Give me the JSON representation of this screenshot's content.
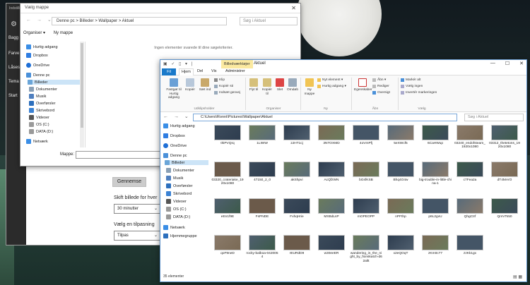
{
  "settings": {
    "title": "Indstillinger",
    "sidebar": [
      "Bagg",
      "Farve",
      "Låsesk",
      "Tema",
      "Start"
    ],
    "browse_button": "Gennemse",
    "time_label": "Skift billede for hver",
    "time_value": "30 minutter",
    "fit_label": "Vælg en tilpasning",
    "fit_value": "Tilpas"
  },
  "dialog": {
    "title": "Vælg mappe",
    "breadcrumb": "Denne pc  >  Billeder  >  Wallpaper  >  Aktuel",
    "search_placeholder": "Søg i Aktuel",
    "toolbar": {
      "organize": "Organiser ▾",
      "new_folder": "Ny mappe"
    },
    "nav_items": [
      "Hurtig adgang",
      "Dropbox",
      "OneDrive",
      "Denne pc",
      "Billeder",
      "Dokumenter",
      "Musik",
      "Overførsler",
      "Skrivebord",
      "Videoer",
      "OS (C:)",
      "DATA (D:)",
      "Netværk"
    ],
    "empty_message": "Ingen elementer svarede til dine søgekriterier.",
    "folder_label": "Mappe:"
  },
  "explorer": {
    "title": "Aktuel",
    "tools_tab": "Billedværktøjer",
    "ribbon_tabs": [
      "Fil",
      "Hjem",
      "Del",
      "Vis",
      "Administrer"
    ],
    "address": "C:\\Users\\Ronni\\Pictures\\Wallpaper\\Aktuel",
    "search_placeholder": "Søg i Aktuel",
    "ribbon": {
      "pin": "Fastgør til Hurtig adgang",
      "copy": "Kopiér",
      "paste": "Sæt ind",
      "cut": "Klip",
      "copy_path": "Kopiér sti",
      "paste_shortcut": "Indsæt genvej",
      "move": "Flyt til",
      "copy_to": "Kopiér til",
      "delete": "Slet",
      "rename": "Omdøb",
      "new_folder": "Ny mappe",
      "new_item": "Nyt element ▾",
      "easy_access": "Hurtig adgang ▾",
      "properties": "Egenskaber",
      "open": "Åbn ▾",
      "edit": "Rediger",
      "history": "Oversigt",
      "select_all": "Markér alt",
      "select_none": "Vælg ingen",
      "invert": "Invertér markeringen",
      "group_clipboard": "Udklipsholder",
      "group_organize": "Organiser",
      "group_new": "Ny",
      "group_open": "Åbn",
      "group_select": "Vælg"
    },
    "nav_items": [
      "Hurtig adgang",
      "Dropbox",
      "OneDrive",
      "Denne pc",
      "Billeder",
      "Dokumenter",
      "Musik",
      "Overførsler",
      "Skrivebord",
      "Videoer",
      "OS (C:)",
      "DATA (D:)",
      "Netværk",
      "Hjemmegruppe"
    ],
    "files": [
      "0kPVQrq",
      "1LIWW",
      "2JHT1cj",
      "3NTOXMD",
      "4oVmPfj",
      "5eXWcf5",
      "6CaHWup",
      "03240_endofsteam_1920x1080",
      "03312_thetetons_1920x1080",
      "03320_crateriake_1920x1080",
      "47150_2_0",
      "akShpvi",
      "AcQfzWN",
      "bGsfKSB",
      "Bhq4O4w",
      "big-trouble-in-little-china-1",
      "c7Fea2a",
      "dT4MArO",
      "eEn1f9E",
      "FsPNDE",
      "FxhqHrie",
      "MXBdLsP",
      "mOPEOPP",
      "nPFthp",
      "p6L2gvU",
      "QhgCtrf",
      "QmVTs50",
      "qoF9neD",
      "rocky-balboa-0420054",
      "rEURdD9",
      "w30eeER",
      "wandering_in_the_night_by_fionskatch-d62altt",
      "x2eQOqT",
      "zKm0c77",
      "zzKk1gx"
    ],
    "status": "35 elementer"
  },
  "colors": {
    "accent": "#1979ca",
    "tools_tab": "#fbe9a0",
    "selection": "#cce4f7",
    "settings_sidebar": "#2b2b2b"
  }
}
